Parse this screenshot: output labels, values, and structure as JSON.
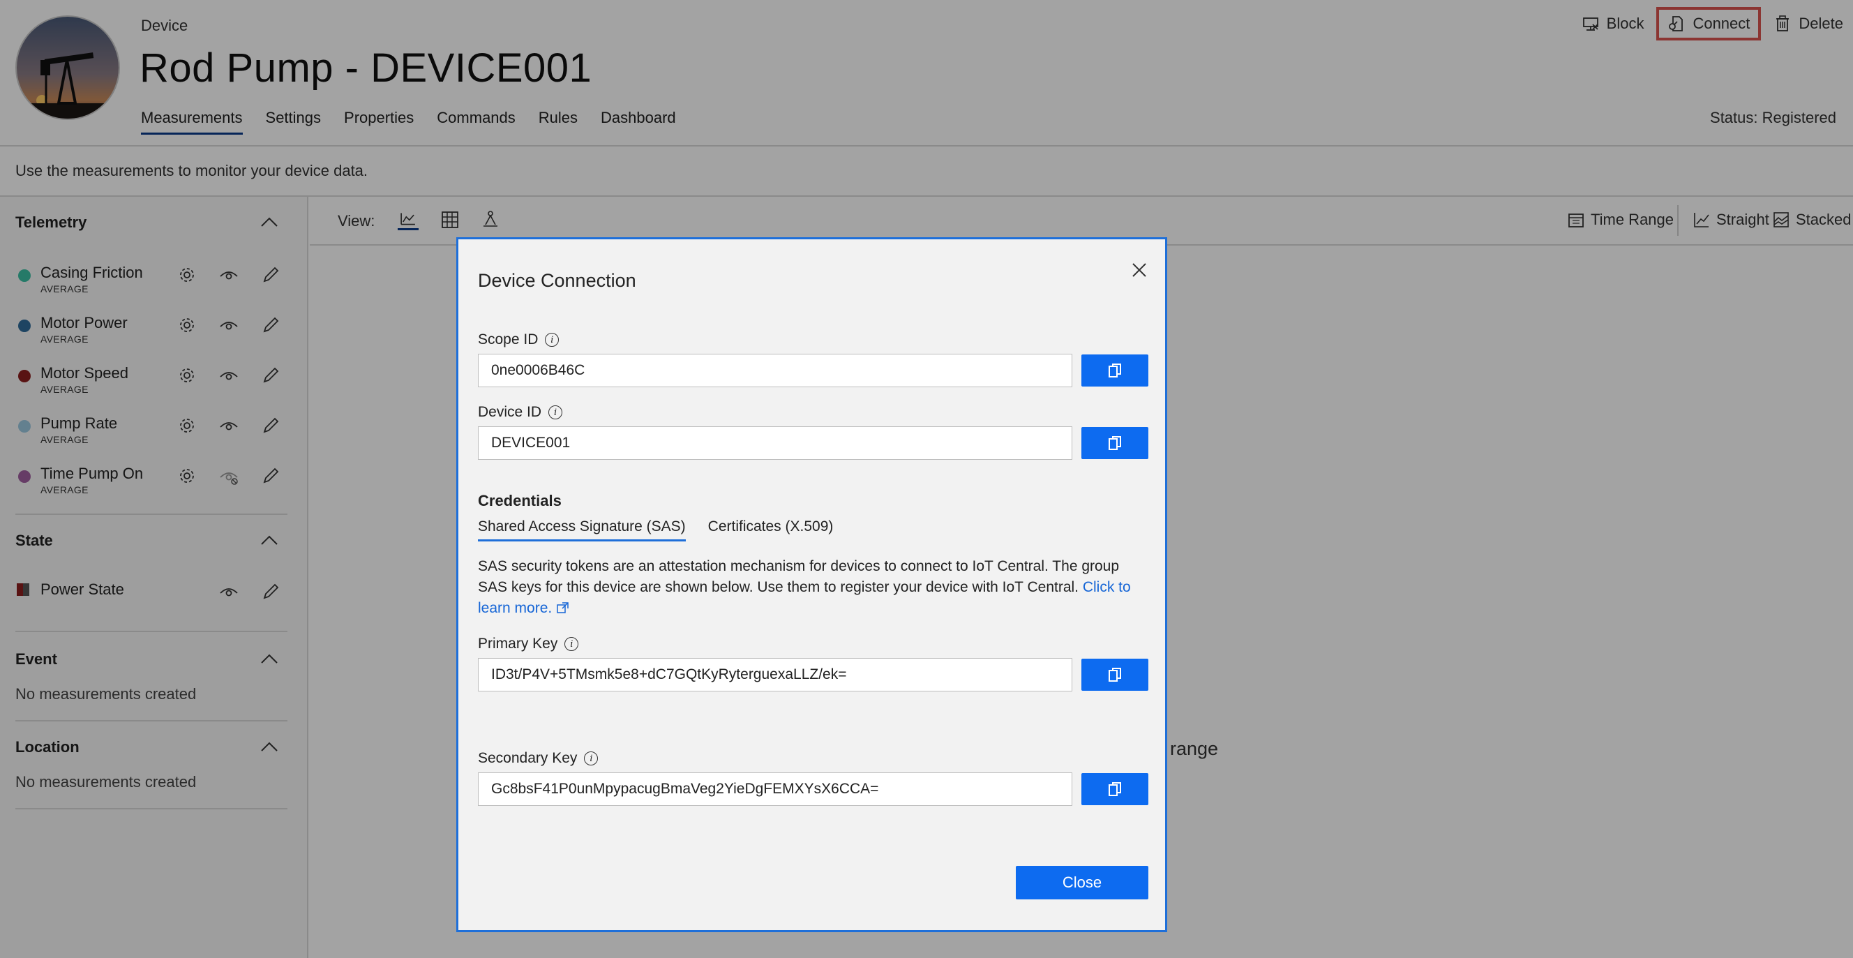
{
  "header": {
    "breadcrumb": "Device",
    "title": "Rod Pump - DEVICE001",
    "tabs": [
      "Measurements",
      "Settings",
      "Properties",
      "Commands",
      "Rules",
      "Dashboard"
    ],
    "status": "Status: Registered",
    "actions": {
      "block": "Block",
      "connect": "Connect",
      "delete": "Delete"
    }
  },
  "description": "Use the measurements to monitor your device data.",
  "sidebar": {
    "telemetry": {
      "heading": "Telemetry",
      "items": [
        {
          "name": "Casing Friction",
          "sub": "AVERAGE",
          "color": "#3bbfa3"
        },
        {
          "name": "Motor Power",
          "sub": "AVERAGE",
          "color": "#2f6b9a"
        },
        {
          "name": "Motor Speed",
          "sub": "AVERAGE",
          "color": "#8b1e1e"
        },
        {
          "name": "Pump Rate",
          "sub": "AVERAGE",
          "color": "#9cc8e0"
        },
        {
          "name": "Time Pump On",
          "sub": "AVERAGE",
          "color": "#a05fa0"
        }
      ]
    },
    "state": {
      "heading": "State",
      "items": [
        {
          "name": "Power State"
        }
      ]
    },
    "event": {
      "heading": "Event",
      "empty": "No measurements created"
    },
    "location": {
      "heading": "Location",
      "empty": "No measurements created"
    }
  },
  "main": {
    "view_label": "View:",
    "time_range": "Time Range",
    "straight": "Straight",
    "stacked": "Stacked",
    "bg_text_1": "a",
    "bg_text_2": "ime range"
  },
  "modal": {
    "title": "Device Connection",
    "scope_id": {
      "label": "Scope ID",
      "value": "0ne0006B46C"
    },
    "device_id": {
      "label": "Device ID",
      "value": "DEVICE001"
    },
    "credentials_heading": "Credentials",
    "tabs": [
      "Shared Access Signature (SAS)",
      "Certificates (X.509)"
    ],
    "sas_text": "SAS security tokens are an attestation mechanism for devices to connect to IoT Central. The group SAS keys for this device are shown below. Use them to register your device with IoT Central.",
    "learn_more": "Click to learn more.",
    "primary_key": {
      "label": "Primary Key",
      "value": "ID3t/P4V+5TMsmk5e8+dC7GQtKyRyterguexaLLZ/ek="
    },
    "secondary_key": {
      "label": "Secondary Key",
      "value": "Gc8bsF41P0unMpypacugBmaVeg2YieDgFEMXYsX6CCA="
    },
    "close": "Close"
  },
  "colors": {
    "accent": "#0d6bf0",
    "highlight": "#d9534f",
    "tab_underline": "#0a3a8a"
  }
}
